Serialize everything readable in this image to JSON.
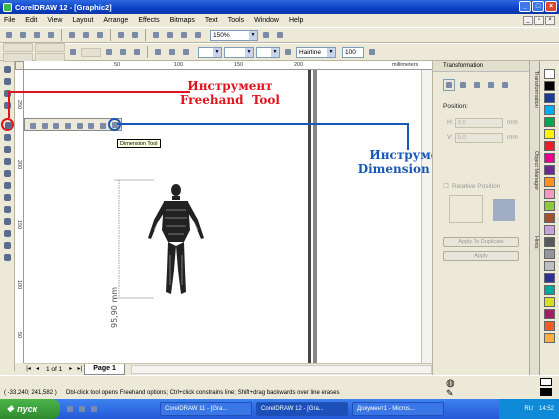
{
  "window": {
    "title": "CorelDRAW 12 - [Graphic2]"
  },
  "menu": [
    "File",
    "Edit",
    "View",
    "Layout",
    "Arrange",
    "Effects",
    "Bitmaps",
    "Text",
    "Tools",
    "Window",
    "Help"
  ],
  "toolbar": {
    "zoom": "150%",
    "outline": "Hairline",
    "size_value": "100"
  },
  "ruler": {
    "unit": "millimeters",
    "ticks_h": [
      "50",
      "100",
      "150",
      "200"
    ],
    "ticks_v": [
      "250",
      "200",
      "150",
      "100",
      "50"
    ]
  },
  "docker": {
    "title": "Transformation",
    "position_label": "Position:",
    "h_label": "H:",
    "h_value": "0,0",
    "v_label": "V:",
    "v_value": "0,0",
    "unit": "mm",
    "relative_position": "Relative Position",
    "apply_to_duplicate": "Apply To Duplicate",
    "apply": "Apply",
    "tabs": [
      "Transformation",
      "Object Manager",
      "Hints"
    ]
  },
  "canvas": {
    "dimension_text": "95,90 mm"
  },
  "tooltip": "Dimension Tool",
  "annotations": {
    "freehand": "Инструмент\nFreehand  Tool",
    "dimension": "Инструмент\nDimension  Tool"
  },
  "page_nav": {
    "position": "1 of 1",
    "tab": "Page 1"
  },
  "status": {
    "coords": "( -33,240; 241,582 )",
    "hint": "Dbl-click tool opens Freehand options; Ctrl+click constrains line; Shift+drag backwards over line erases"
  },
  "taskbar": {
    "start": "пуск",
    "tasks": [
      "CorelDRAW 11 - [Gra...",
      "CorelDRAW 12 - [Gra...",
      "Документ1 - Micros..."
    ],
    "lang": "RU",
    "clock": "14:52"
  },
  "colors": {
    "annotation_red": "#e0141e",
    "annotation_blue": "#1a58b8",
    "highlight_circle": "#1a58b8"
  }
}
